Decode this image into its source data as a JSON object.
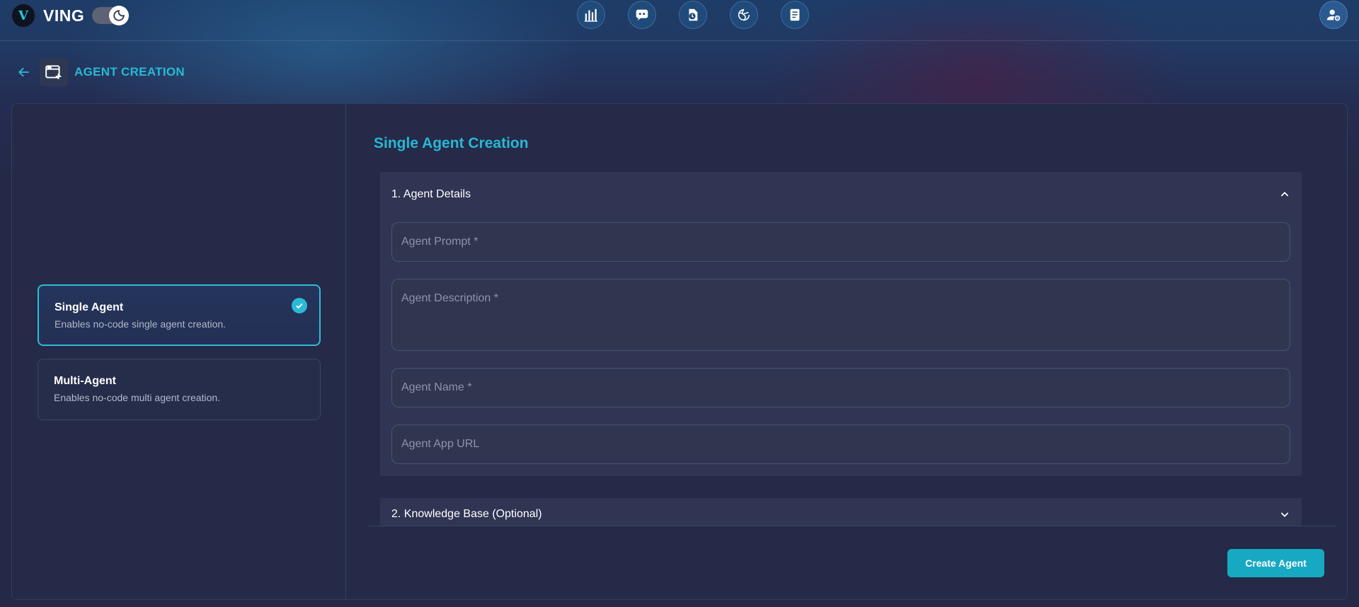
{
  "app": {
    "name": "VING",
    "logo_letter": "V"
  },
  "topbar": {
    "nav_icons": [
      "analytics-icon",
      "agent-chat-icon",
      "timer-icon",
      "brain-icon",
      "document-icon"
    ],
    "user_icon": "user-settings-icon"
  },
  "page": {
    "title": "AGENT CREATION"
  },
  "agent_types": [
    {
      "title": "Single Agent",
      "description": "Enables no-code single agent creation.",
      "selected": true
    },
    {
      "title": "Multi-Agent",
      "description": "Enables no-code multi agent creation.",
      "selected": false
    }
  ],
  "form": {
    "title": "Single Agent Creation",
    "sections": [
      {
        "label": "1. Agent Details",
        "expanded": true
      },
      {
        "label": "2. Knowledge Base (Optional)",
        "expanded": false
      }
    ],
    "fields": {
      "prompt": {
        "placeholder": "Agent Prompt *",
        "value": ""
      },
      "description": {
        "placeholder": "Agent Description *",
        "value": ""
      },
      "name": {
        "placeholder": "Agent Name *",
        "value": ""
      },
      "app_url": {
        "placeholder": "Agent App URL",
        "value": ""
      }
    },
    "submit_label": "Create Agent"
  },
  "colors": {
    "accent": "#29b7d3",
    "button": "#18a9c2",
    "panel": "#242a47",
    "section": "#2f3552"
  }
}
